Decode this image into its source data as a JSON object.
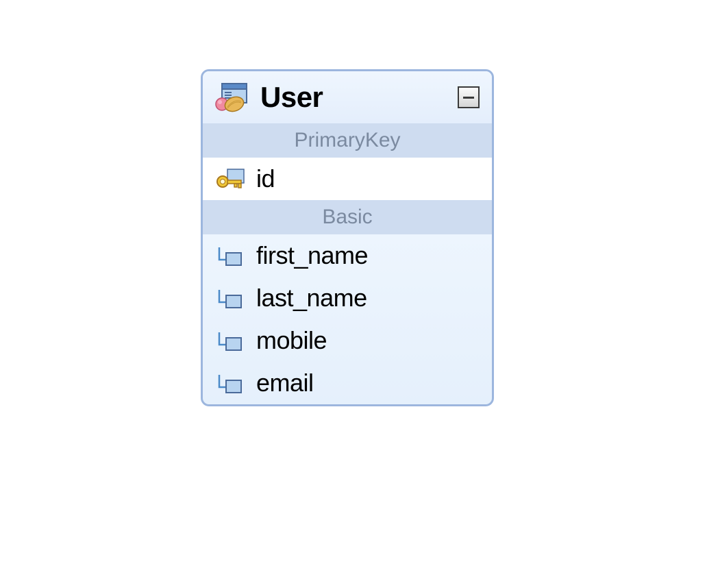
{
  "entity": {
    "title": "User",
    "sections": {
      "primaryKey": {
        "label": "PrimaryKey",
        "fields": {
          "id": "id"
        }
      },
      "basic": {
        "label": "Basic",
        "fields": {
          "first_name": "first_name",
          "last_name": "last_name",
          "mobile": "mobile",
          "email": "email"
        }
      }
    }
  }
}
